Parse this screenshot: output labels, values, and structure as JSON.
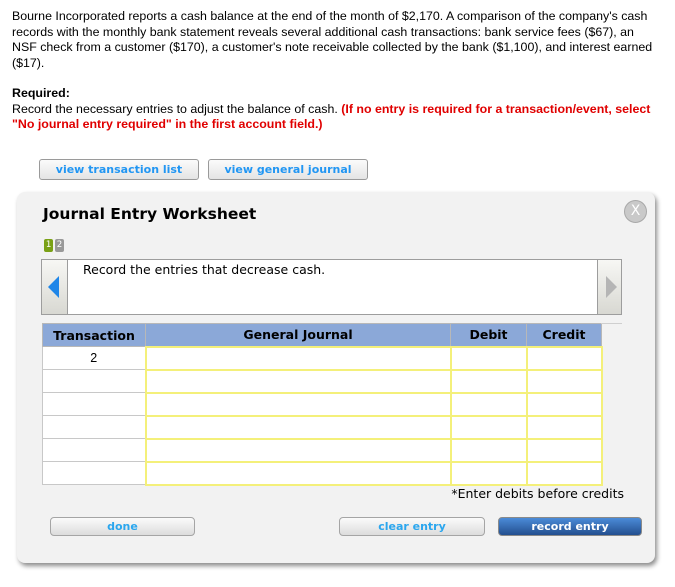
{
  "problem": {
    "paragraph": "Bourne Incorporated reports a cash balance at the end of the month of $2,170. A comparison of the company's cash records with the monthly bank statement reveals several additional cash transactions: bank service fees ($67), an NSF check from a customer ($170), a customer's note receivable collected by the bank ($1,100), and interest earned ($17).",
    "required_label": "Required:",
    "required_text": "Record the necessary entries to adjust the balance of cash.",
    "required_note": "(If no entry is required for a transaction/event, select \"No journal entry required\" in the first account field.)"
  },
  "top_buttons": {
    "transaction_list": "view transaction list",
    "general_journal": "view general journal"
  },
  "worksheet": {
    "title": "Journal Entry Worksheet",
    "close_label": "X",
    "steps": [
      {
        "label": "1",
        "active": true
      },
      {
        "label": "2",
        "active": false
      }
    ],
    "prompt": "Record the entries that decrease cash.",
    "table": {
      "headers": {
        "transaction": "Transaction",
        "general_journal": "General Journal",
        "debit": "Debit",
        "credit": "Credit"
      },
      "rows": [
        {
          "transaction": "2",
          "account": "",
          "debit": "",
          "credit": ""
        },
        {
          "transaction": "",
          "account": "",
          "debit": "",
          "credit": ""
        },
        {
          "transaction": "",
          "account": "",
          "debit": "",
          "credit": ""
        },
        {
          "transaction": "",
          "account": "",
          "debit": "",
          "credit": ""
        },
        {
          "transaction": "",
          "account": "",
          "debit": "",
          "credit": ""
        },
        {
          "transaction": "",
          "account": "",
          "debit": "",
          "credit": ""
        }
      ]
    },
    "note": "*Enter debits before credits",
    "buttons": {
      "done": "done",
      "clear": "clear entry",
      "record": "record entry"
    }
  },
  "colors": {
    "required_note": "#e00000",
    "step_active": "#7aa116",
    "step_inactive": "#999999",
    "table_header": "#8ba8d8",
    "input_border": "#f4f07a",
    "button_text": "#2aa6ee",
    "primary_button": "#234f8f",
    "nav_arrow_active": "#1f86e8"
  }
}
